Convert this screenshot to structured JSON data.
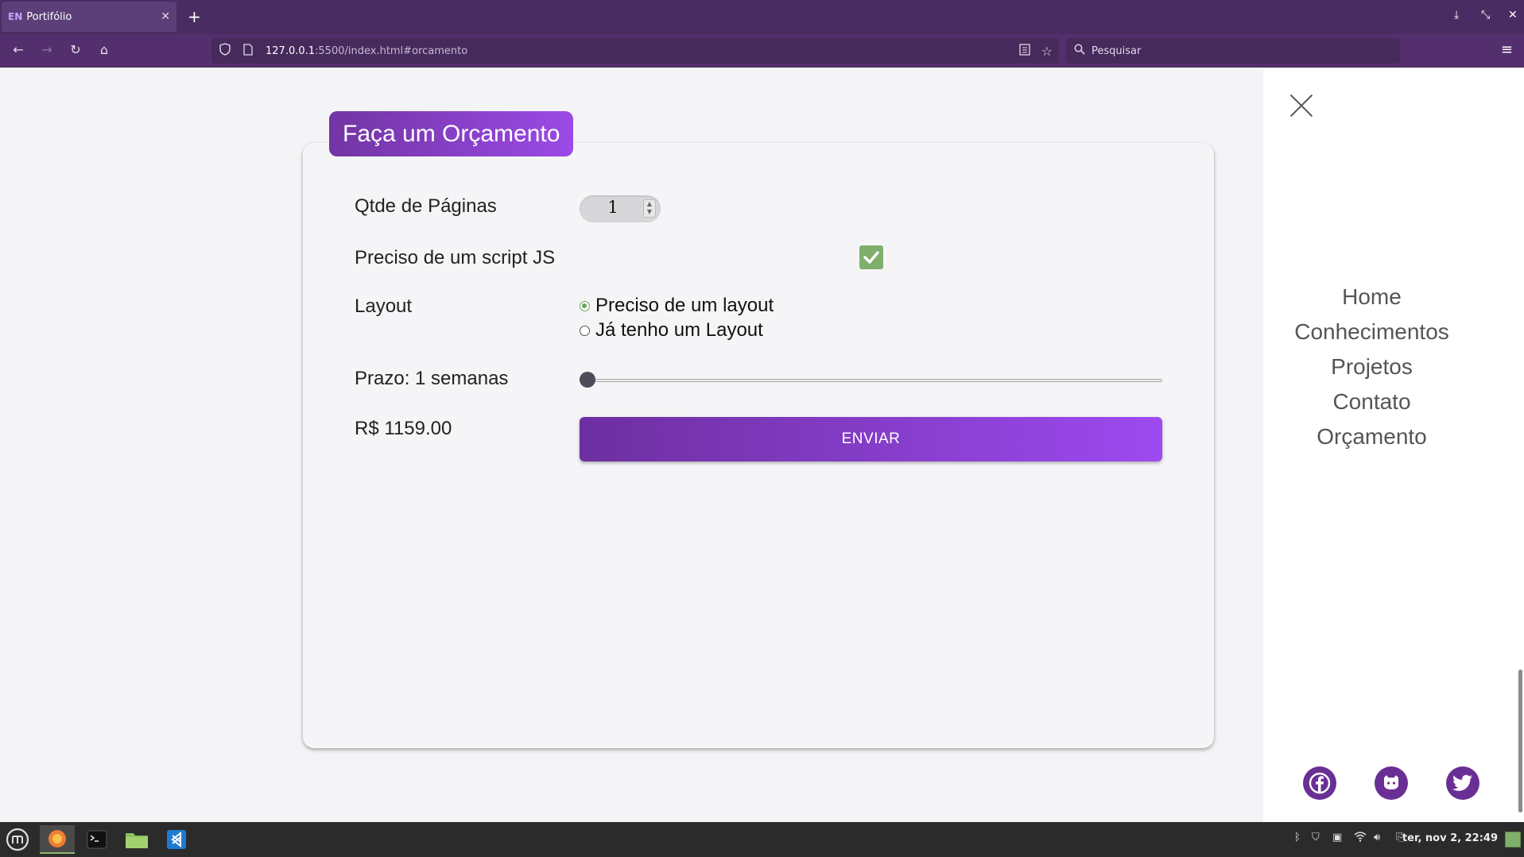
{
  "browser": {
    "tab": {
      "favicon": "EN",
      "title": "Portifólio",
      "close": "✕"
    },
    "new_tab": "+",
    "nav": {
      "back": "←",
      "forward": "→",
      "reload": "↻",
      "home": "⌂"
    },
    "url": {
      "host": "127.0.0.1",
      "path": ":5500/index.html#orcamento"
    },
    "search_placeholder": "Pesquisar",
    "menu": "≡",
    "window": {
      "download": "⤓",
      "restore": "⤡",
      "close": "✕"
    }
  },
  "form": {
    "title": "Faça um Orçamento",
    "pages_label": "Qtde de Páginas",
    "pages_value": "1",
    "script_label": "Preciso de um script JS",
    "script_checked": true,
    "layout_label": "Layout",
    "layout_options": [
      {
        "label": "Preciso de um layout",
        "checked": true
      },
      {
        "label": "Já tenho um Layout",
        "checked": false
      }
    ],
    "deadline_label": "Prazo: 1 semanas",
    "deadline_slider_fraction": 0.0,
    "price": "R$ 1159.00",
    "submit_label": "ENVIAR"
  },
  "sidemenu": {
    "links": [
      "Home",
      "Conhecimentos",
      "Projetos",
      "Contato",
      "Orçamento"
    ],
    "social": [
      "facebook-icon",
      "github-icon",
      "twitter-icon"
    ],
    "accent": "#6a2f95"
  },
  "taskbar": {
    "clock": "ter, nov 2, 22:49"
  }
}
